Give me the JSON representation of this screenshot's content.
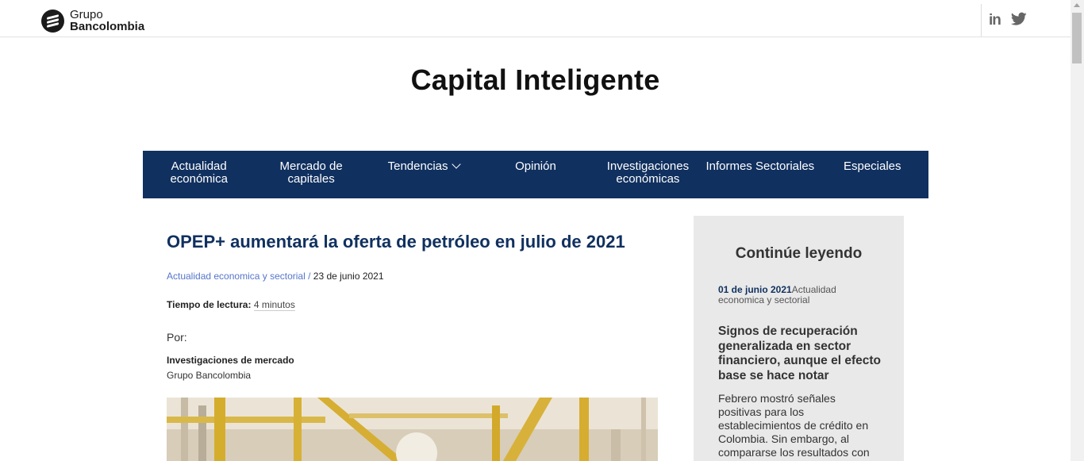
{
  "header": {
    "logo_line1": "Grupo",
    "logo_line2": "Bancolombia",
    "social": [
      "linkedin-icon",
      "twitter-icon"
    ],
    "linkedin_label": "in"
  },
  "site_title": "Capital Inteligente",
  "nav": {
    "items": [
      {
        "label": "Actualidad económica"
      },
      {
        "label": "Mercado de capitales"
      },
      {
        "label": "Tendencias",
        "has_dropdown": true
      },
      {
        "label": "Opinión"
      },
      {
        "label": "Investigaciones económicas"
      },
      {
        "label": "Informes Sectoriales"
      },
      {
        "label": "Especiales"
      }
    ]
  },
  "article": {
    "title": "OPEP+ aumentará la oferta de petróleo en julio de 2021",
    "category": "Actualidad economica y sectorial /",
    "date": "23 de junio 2021",
    "reading_label": "Tiempo de lectura:",
    "reading_value": "4 minutos",
    "by": "Por:",
    "author": "Investigaciones de mercado",
    "organization": "Grupo Bancolombia"
  },
  "aside": {
    "heading": "Continúe leyendo",
    "date": "01 de junio 2021",
    "category": "Actualidad economica y sectorial",
    "title": "Signos de recuperación generalizada en sector financiero, aunque el efecto base se hace notar",
    "excerpt": "Febrero mostró señales positivas para los establecimientos de crédito en Colombia. Sin embargo, al compararse los resultados con"
  },
  "colors": {
    "nav_bg": "#10305f",
    "title": "#10305f",
    "category_link": "#5576c9",
    "aside_bg": "#e9e9e9"
  }
}
